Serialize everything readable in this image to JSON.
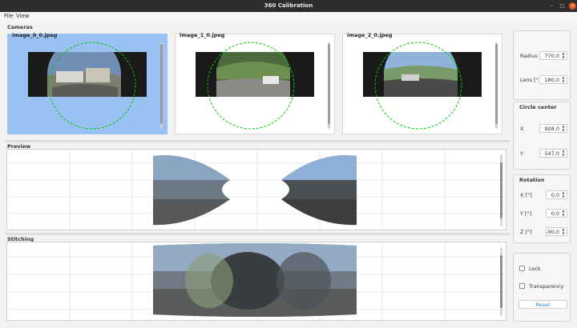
{
  "window": {
    "title": "360 Calibration"
  },
  "menu": {
    "items": [
      "File",
      "View"
    ]
  },
  "cameras": {
    "label": "Cameras",
    "items": [
      {
        "name": "image_0_0.jpeg",
        "selected": true
      },
      {
        "name": "image_1_0.jpeg",
        "selected": false
      },
      {
        "name": "image_2_0.jpeg",
        "selected": false
      }
    ]
  },
  "preview": {
    "label": "Preview"
  },
  "stitching": {
    "label": "Stitching"
  },
  "lens_group": {
    "radius_label": "Radius",
    "radius_value": "770,0",
    "lens_label": "Lens [°]",
    "lens_value": "180,0"
  },
  "circle_center": {
    "title": "Circle center",
    "x_label": "X",
    "x_value": "928,0",
    "y_label": "Y",
    "y_value": "547,0"
  },
  "rotation": {
    "title": "Rotation",
    "x_label": "X [°]",
    "x_value": "0,0",
    "y_label": "Y [°]",
    "y_value": "0,0",
    "z_label": "Z [°]",
    "z_value": "-90,0"
  },
  "options": {
    "lock_label": "Lock",
    "lock_checked": false,
    "transparency_label": "Transparency",
    "transparency_checked": false,
    "reset_label": "Reset"
  },
  "colors": {
    "selection": "#99c1f1",
    "circle_overlay": "#00c800",
    "accent": "#3584e4",
    "close_button": "#e95420",
    "titlebar": "#2d2d2d"
  }
}
